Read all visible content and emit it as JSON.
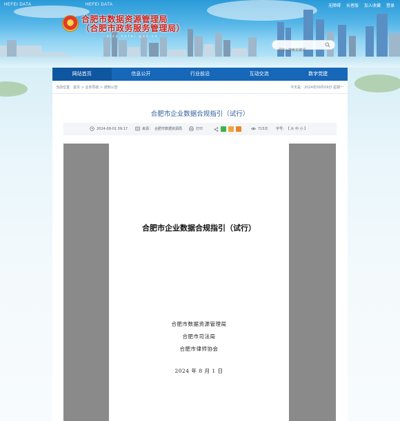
{
  "banner": {
    "tag_left": "HEFEI DATA",
    "tag_center": "HEFEI DATA",
    "agency_line1": "合肥市数据资源管理局",
    "agency_line2": "（合肥市政务服务管理局）",
    "agency_sub": "sjzy.hefei.gov.cn",
    "top_links": [
      "无障碍",
      "长者版",
      "加入收藏",
      "登录"
    ],
    "search_placeholder": "请输入搜索关键词"
  },
  "nav": {
    "items": [
      "网站首页",
      "信息公开",
      "行业前沿",
      "互动交流",
      "数字党建"
    ]
  },
  "breadcrumb": {
    "label": "当前位置：首页 > 业务导航 > 通知公告",
    "today": "今天是：2024年09月09日 星期一"
  },
  "article": {
    "title": "合肥市企业数据合规指引（试行）",
    "date": "2024-08-01 09:17",
    "source_label": "来源：",
    "source": "合肥市数据资源局",
    "print": "打印",
    "views": "715次",
    "font_label": "字号:",
    "font_sizes": "【 大 中 小 】"
  },
  "document": {
    "title": "合肥市企业数据合规指引（试行）",
    "issuers": [
      "合肥市数据资源管理局",
      "合肥市司法局",
      "合肥市律师协会"
    ],
    "date": "2024 年 8 月 1 日"
  },
  "colors": {
    "nav_blue": "#1667b8",
    "title_blue": "#2f5f98",
    "agency_red": "#c8231b",
    "viewer_gray": "#8a8a8a"
  },
  "icons": {
    "clock": "clock-icon",
    "source": "source-icon",
    "print": "print-icon",
    "share": "share-icon",
    "views": "eye-icon",
    "search": "search-icon"
  }
}
